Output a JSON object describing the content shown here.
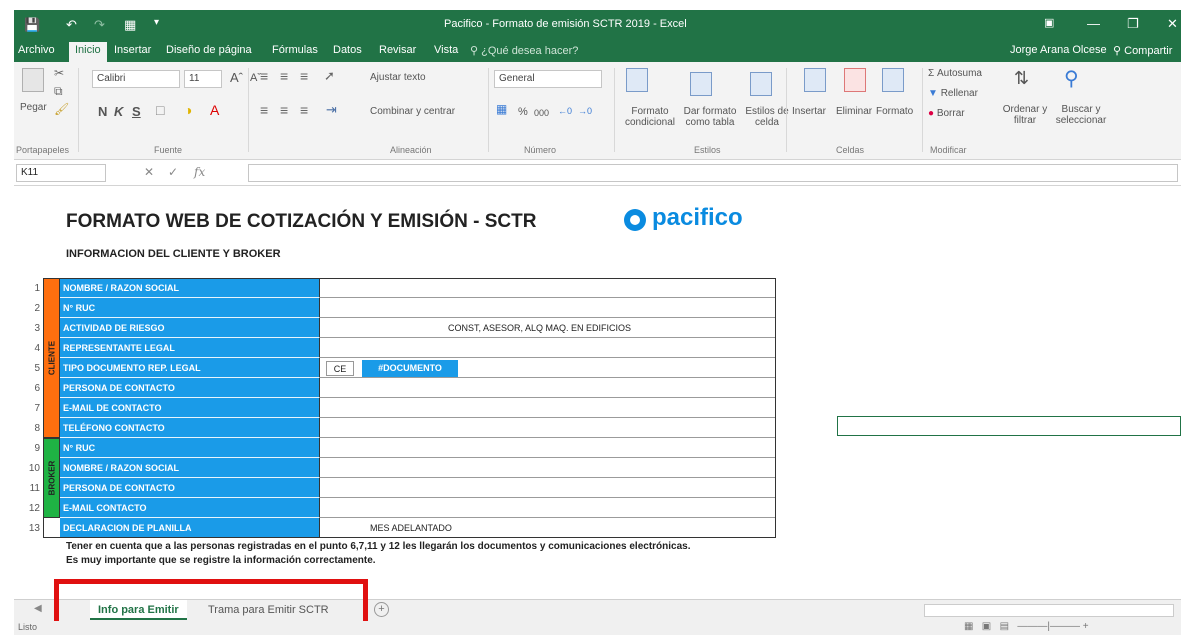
{
  "window": {
    "title": "Pacifico - Formato de emisión SCTR 2019 - Excel",
    "user": "Jorge Arana Olcese",
    "share_label": "Compartir"
  },
  "menu": {
    "tabs": [
      "Archivo",
      "Inicio",
      "Insertar",
      "Diseño de página",
      "Fórmulas",
      "Datos",
      "Revisar",
      "Vista"
    ],
    "help": "¿Qué desea hacer?"
  },
  "ribbon": {
    "paste": "Pegar",
    "font_name": "Calibri",
    "font_size": "11",
    "bold": "N",
    "italic": "K",
    "underline": "S",
    "wrap_text": "Ajustar texto",
    "merge_center": "Combinar y centrar",
    "number_format": "General",
    "percent": "%",
    "thousands": "000",
    "cond_format": "Formato condicional",
    "format_table": "Dar formato como tabla",
    "cell_styles": "Estilos de celda",
    "insert": "Insertar",
    "delete": "Eliminar",
    "format": "Formato",
    "autosum": "Autosuma",
    "fill": "Rellenar",
    "clear": "Borrar",
    "sort_filter": "Ordenar y filtrar",
    "find_select": "Buscar y seleccionar",
    "groups": [
      "Portapapeles",
      "Fuente",
      "Alineación",
      "Número",
      "Estilos",
      "Celdas",
      "Modificar"
    ]
  },
  "formula_bar": {
    "name_box": "K11",
    "fx": "fx"
  },
  "sheet": {
    "title": "FORMATO WEB DE COTIZACIÓN Y EMISIÓN - SCTR",
    "logo_text": "pacifico",
    "subtitle": "INFORMACION DEL CLIENTE Y BROKER",
    "group_cliente": "CLIENTE",
    "group_broker": "BROKER",
    "rows": [
      {
        "num": "1",
        "label": "NOMBRE / RAZON SOCIAL",
        "value": ""
      },
      {
        "num": "2",
        "label": "N° RUC",
        "value": ""
      },
      {
        "num": "3",
        "label": "ACTIVIDAD DE RIESGO",
        "value": "CONST, ASESOR, ALQ MAQ. EN EDIFICIOS"
      },
      {
        "num": "4",
        "label": "REPRESENTANTE LEGAL",
        "value": ""
      },
      {
        "num": "5",
        "label": "TIPO DOCUMENTO REP. LEGAL",
        "value": ""
      },
      {
        "num": "6",
        "label": "PERSONA DE CONTACTO",
        "value": ""
      },
      {
        "num": "7",
        "label": "E-MAIL DE CONTACTO",
        "value": ""
      },
      {
        "num": "8",
        "label": "TELÉFONO CONTACTO",
        "value": ""
      },
      {
        "num": "9",
        "label": "N° RUC",
        "value": ""
      },
      {
        "num": "10",
        "label": "NOMBRE / RAZON SOCIAL",
        "value": ""
      },
      {
        "num": "11",
        "label": "PERSONA DE CONTACTO",
        "value": ""
      },
      {
        "num": "12",
        "label": "E-MAIL CONTACTO",
        "value": ""
      },
      {
        "num": "13",
        "label": "DECLARACION DE PLANILLA",
        "value": "MES ADELANTADO"
      }
    ],
    "doc_type": "CE",
    "doc_button": "#DOCUMENTO",
    "note_1": "Tener en cuenta que a las personas registradas en el punto 6,7,11 y 12 les llegarán los documentos y comunicaciones electrónicas.",
    "note_2": "Es muy importante que se registre la información correctamente."
  },
  "tabs": {
    "active": "Info para Emitir",
    "inactive": "Trama para Emitir SCTR"
  },
  "status": {
    "ready": "Listo"
  },
  "colors": {
    "excel_green": "#217346",
    "label_blue": "#1a9be8",
    "cliente_orange": "#ff6f0f",
    "broker_green": "#1fb344",
    "highlight_red": "#e01010"
  }
}
